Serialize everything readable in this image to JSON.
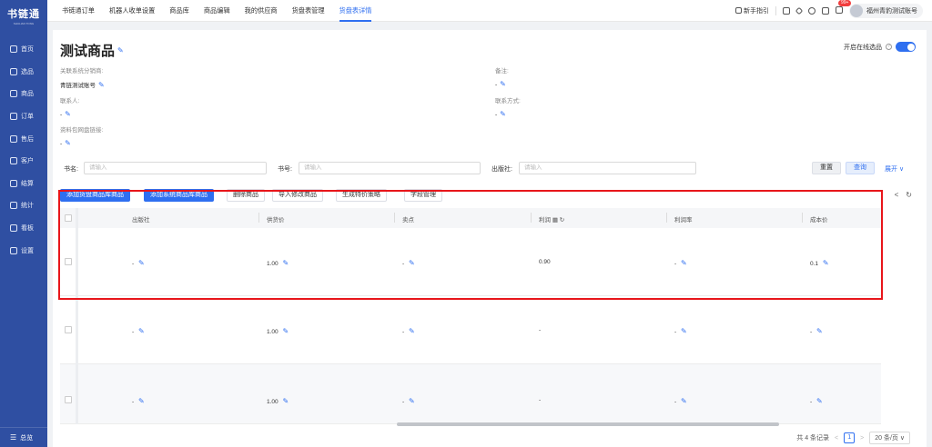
{
  "sidebar": {
    "logo_title": "书链通",
    "logo_sub": "SHULIAN TONG",
    "items": [
      {
        "label": "首页",
        "icon": "monitor-icon"
      },
      {
        "label": "选品",
        "icon": "select-icon"
      },
      {
        "label": "商品",
        "icon": "goods-icon"
      },
      {
        "label": "订单",
        "icon": "order-icon"
      },
      {
        "label": "售后",
        "icon": "aftersale-icon"
      },
      {
        "label": "客户",
        "icon": "customer-icon"
      },
      {
        "label": "结算",
        "icon": "settlement-icon"
      },
      {
        "label": "统计",
        "icon": "stats-icon"
      },
      {
        "label": "看板",
        "icon": "board-icon"
      },
      {
        "label": "设置",
        "icon": "settings-icon"
      }
    ],
    "footer": "总览"
  },
  "topbar": {
    "tabs": [
      "书链通订单",
      "机器人收单设置",
      "商品库",
      "商品编辑",
      "我的供应商",
      "货盘表管理",
      "货盘表详情"
    ],
    "active_tab": 6,
    "guide": "新手指引",
    "badge": "99+",
    "user_name": "福州青豹测试账号"
  },
  "header": {
    "title": "测试商品",
    "toggle_label": "开启在线选品",
    "toggle_on": true
  },
  "info": {
    "distributor_label": "关联系统分销商:",
    "distributor_value": "青链测试账号",
    "remark_label": "备注:",
    "remark_value": "-",
    "contact_label": "联系人:",
    "contact_value": "-",
    "contact_method_label": "联系方式:",
    "contact_method_value": "-",
    "netdisk_label": "资料包网盘链接:",
    "netdisk_value": "-"
  },
  "search": {
    "book_label": "书名:",
    "book_placeholder": "请输入",
    "isbn_label": "书号:",
    "isbn_placeholder": "请输入",
    "publisher_label": "出版社:",
    "publisher_placeholder": "请输入",
    "reset": "重置",
    "query": "查询",
    "expand": "展开"
  },
  "actions": {
    "add_pallet": "添加货盘商品库商品",
    "add_system": "添加系统商品库商品",
    "delete": "删除商品",
    "import": "导入修改商品",
    "special_price": "生成特价策略",
    "field_manage": "字段管理"
  },
  "table": {
    "columns": [
      "出版社",
      "供货价",
      "卖点",
      "利润",
      "利润率",
      "成本价"
    ],
    "rows": [
      {
        "publisher": "-",
        "supply_price": "1.00",
        "selling_point": "-",
        "profit": "0.90",
        "profit_rate": "-",
        "cost": "0.1"
      },
      {
        "publisher": "-",
        "supply_price": "1.00",
        "selling_point": "-",
        "profit": "-",
        "profit_rate": "-",
        "cost": "-"
      },
      {
        "publisher": "-",
        "supply_price": "1.00",
        "selling_point": "-",
        "profit": "-",
        "profit_rate": "-",
        "cost": "-"
      }
    ]
  },
  "pager": {
    "total": "共 4 条记录",
    "current": "1",
    "page_size": "20 条/页"
  },
  "colors": {
    "sidebar": "#2f4fa2",
    "accent": "#2f6ff0",
    "highlight": "#e8161b"
  }
}
